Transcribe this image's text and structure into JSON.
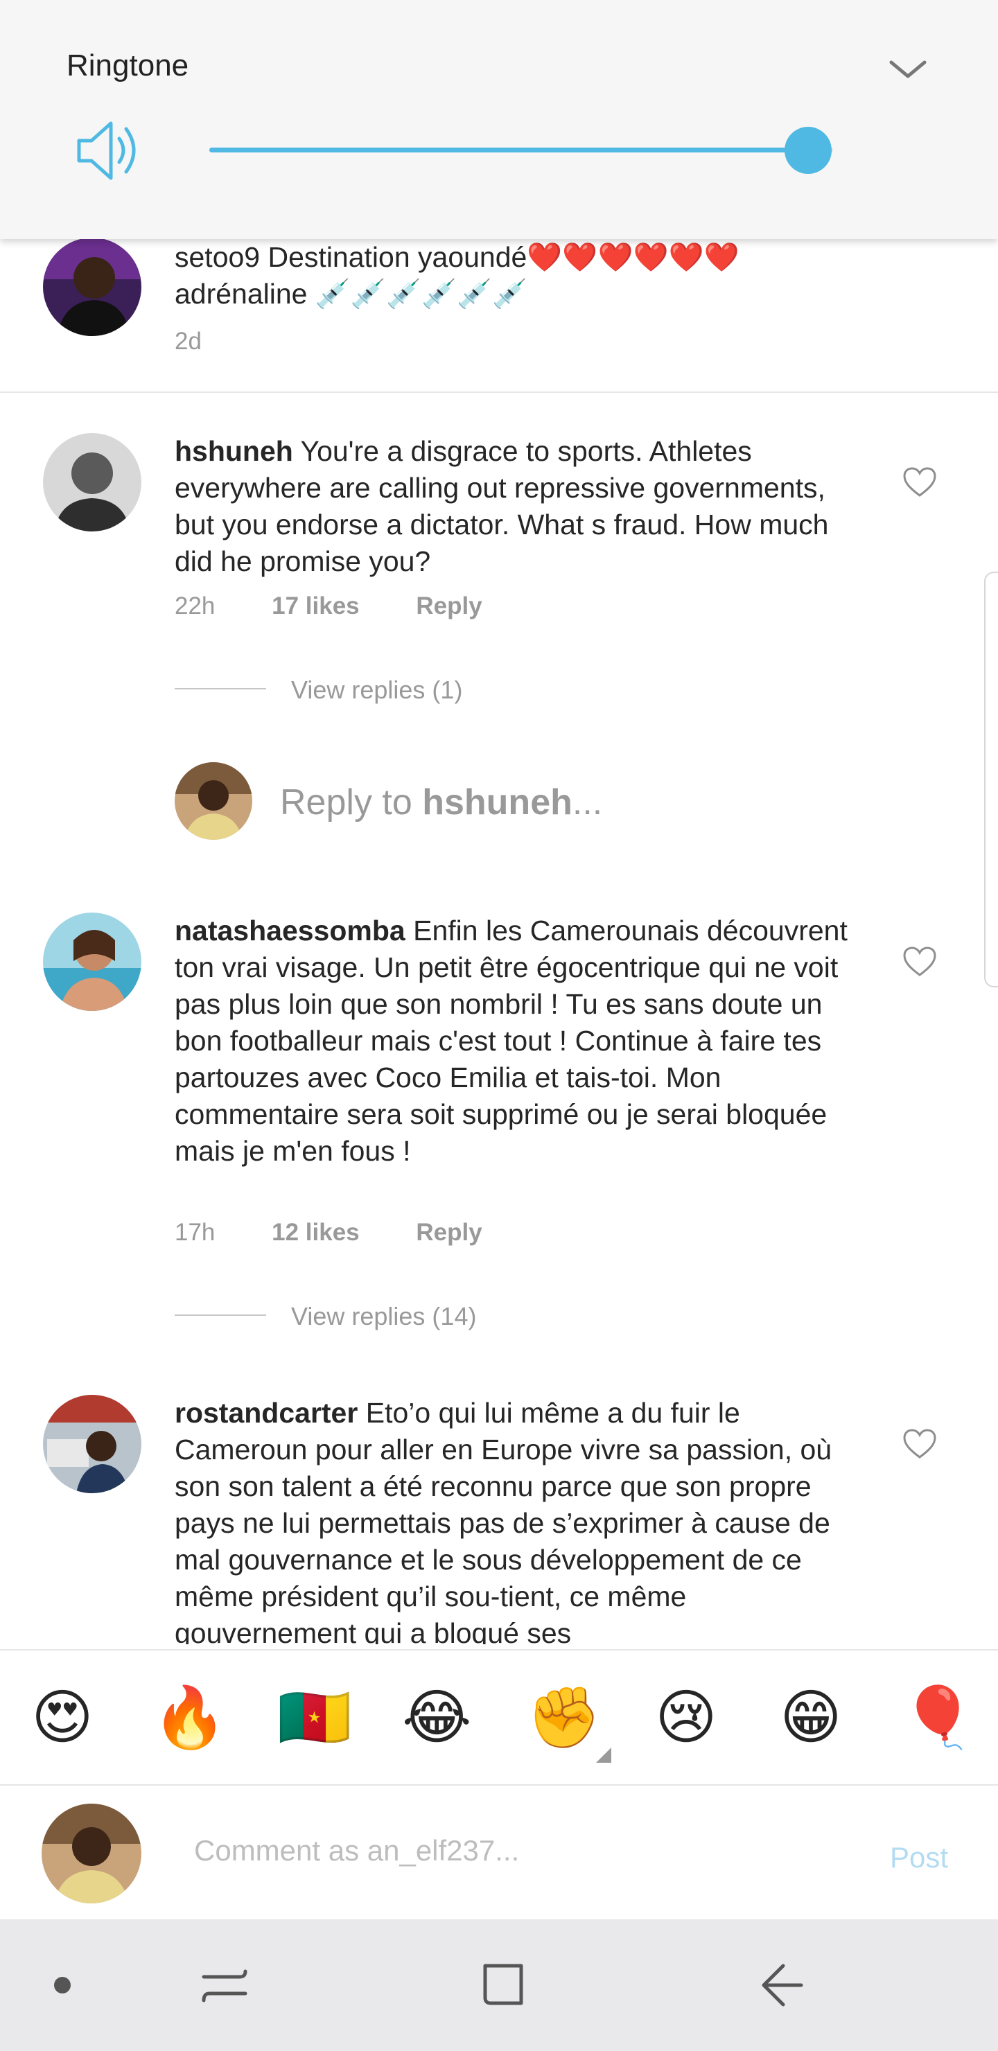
{
  "volume": {
    "title": "Ringtone",
    "level": 0.96
  },
  "comments": [
    {
      "username": "setoo9",
      "text": "Destination yaoundé❤️❤️❤️❤️❤️❤️adrénaline 💉💉💉💉💉💉",
      "time": "2d"
    },
    {
      "username": "hshuneh",
      "text": "You're a disgrace to sports. Athletes everywhere are calling out repressive governments, but you endorse a dictator. What s fraud. How much did he promise you?",
      "time": "22h",
      "likes": "17 likes",
      "reply_label": "Reply",
      "view_replies": "View replies (1)"
    },
    {
      "username": "natashaessomba",
      "text": "Enfin les Camerounais découvrent ton vrai visage. Un petit être égocentrique qui ne voit pas plus loin que son nombril ! Tu es sans doute un bon footballeur mais c'est tout ! Continue à faire tes partouzes avec Coco Emilia et tais-toi. Mon commentaire sera soit supprimé ou je serai bloquée mais je m'en fous !",
      "time": "17h",
      "likes": "12 likes",
      "reply_label": "Reply",
      "view_replies": "View replies (14)"
    },
    {
      "username": "rostandcarter",
      "text": "Eto’o qui lui même a du fuir le Cameroun pour aller en Europe vivre sa passion, où son son talent a été reconnu  parce que son propre pays ne lui permettais pas de s’exprimer à cause de mal gouvernance et le sous développement de ce même président qu’il sou-tient, ce même gouvernement qui a bloqué ses"
    }
  ],
  "reply_prompt": {
    "prefix": "Reply to ",
    "username": "hshuneh",
    "suffix": "..."
  },
  "emoji_bar": [
    "😍",
    "🔥",
    "🇨🇲",
    "😂",
    "✊",
    "😢",
    "😁",
    "🎈"
  ],
  "composer": {
    "placeholder": "Comment as an_elf237...",
    "post_label": "Post"
  },
  "colors": {
    "accent": "#4fb9e3",
    "post_disabled": "#b3dbf2",
    "meta_text": "#999999",
    "nav_bg": "#e9e9eb"
  },
  "icons": {
    "volume": "speaker-icon",
    "collapse": "chevron-down-icon",
    "like": "heart-outline-icon",
    "nav": [
      "dot-icon",
      "recents-icon",
      "home-icon",
      "back-icon"
    ]
  }
}
